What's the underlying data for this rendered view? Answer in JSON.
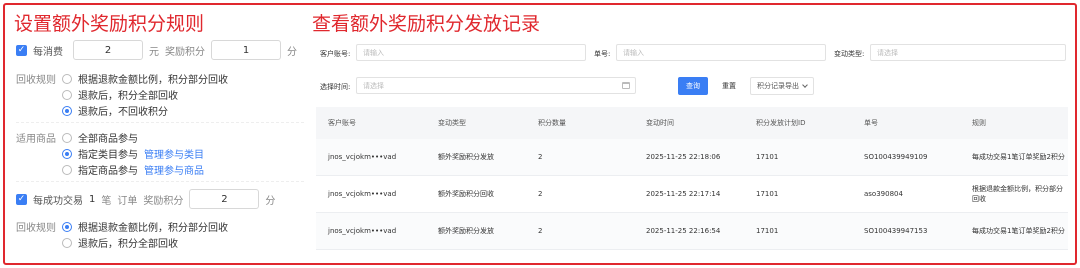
{
  "headings": {
    "left": "设置额外奖励积分规则",
    "right": "查看额外奖励积分发放记录"
  },
  "rule1": {
    "checkbox_label": "每消费",
    "amount": "2",
    "unit": "元",
    "reward_label": "奖励积分",
    "points": "1",
    "points_unit": "分",
    "reclaim_label": "回收规则",
    "options": [
      "根据退款金额比例，积分部分回收",
      "退款后，积分全部回收",
      "退款后，不回收积分"
    ],
    "selected_index": 2
  },
  "products": {
    "label": "适用商品",
    "options": [
      "全部商品参与",
      "指定类目参与",
      "指定商品参与"
    ],
    "links": [
      "",
      "管理参与类目",
      "管理参与商品"
    ],
    "selected_index": 1
  },
  "rule2": {
    "checkbox_label": "每成功交易",
    "count": "1",
    "count_unit": "笔",
    "order_label": "订单",
    "reward_label": "奖励积分",
    "points": "2",
    "points_unit": "分",
    "reclaim_label": "回收规则",
    "options": [
      "根据退款金额比例，积分部分回收",
      "退款后，积分全部回收"
    ],
    "selected_index": 0
  },
  "filters": {
    "account_label": "客户账号:",
    "account_placeholder": "请输入",
    "order_label": "单号:",
    "order_placeholder": "请输入",
    "type_label": "变动类型:",
    "type_placeholder": "请选择",
    "time_label": "选择时间:",
    "time_placeholder": "请选择",
    "query_button": "查询",
    "reset_button": "重置",
    "export_button": "积分记录导出"
  },
  "table": {
    "headers": [
      "客户账号",
      "变动类型",
      "积分数量",
      "变动时间",
      "积分发放计划ID",
      "单号",
      "规则"
    ],
    "rows": [
      [
        "jnos_vcjokm•••vad",
        "额外奖励积分发放",
        "2",
        "2025-11-25 22:18:06",
        "17101",
        "SO100439949109",
        "每成功交易1笔订单奖励2积分"
      ],
      [
        "jnos_vcjokm•••vad",
        "额外奖励积分回收",
        "2",
        "2025-11-25 22:17:14",
        "17101",
        "aso390804",
        "根据退款金额比例，积分部分回收"
      ],
      [
        "jnos_vcjokm•••vad",
        "额外奖励积分发放",
        "2",
        "2025-11-25 22:16:54",
        "17101",
        "SO100439947153",
        "每成功交易1笔订单奖励2积分"
      ]
    ]
  },
  "colors": {
    "accent": "#3a7ef4",
    "heading_red": "#e0282e"
  }
}
